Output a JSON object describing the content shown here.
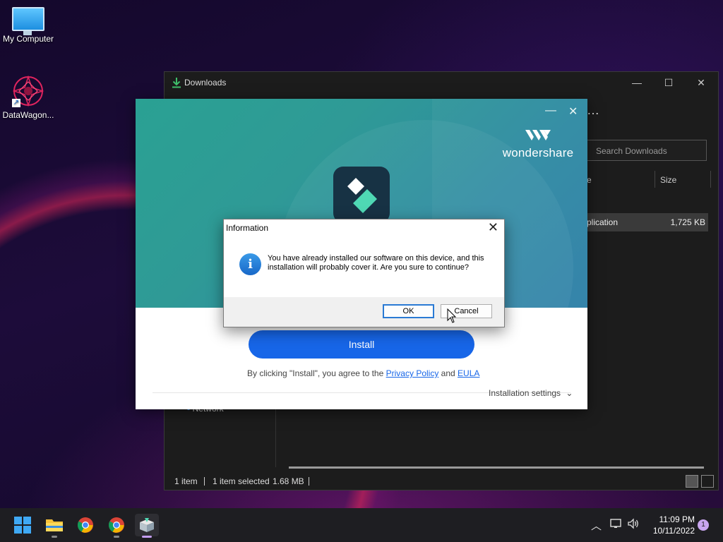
{
  "desktop": {
    "icons": [
      {
        "label": "My Computer"
      },
      {
        "label": "DataWagon..."
      }
    ]
  },
  "explorer": {
    "title": "Downloads",
    "search_placeholder": "Search Downloads",
    "columns": {
      "type_partial": "e",
      "size": "Size"
    },
    "file": {
      "type_partial": "plication",
      "size": "1,725 KB"
    },
    "nav_partial": "Network",
    "status": {
      "count": "1 item",
      "selected": "1 item selected",
      "size": "1.68 MB"
    }
  },
  "installer": {
    "brand": "wondershare",
    "install_label": "Install",
    "agree_text": "By clicking \"Install\", you agree to the",
    "privacy_label": "Privacy Policy",
    "and_text": "and",
    "eula_label": "EULA",
    "settings_label": "Installation settings"
  },
  "dialog": {
    "title": "Information",
    "message": "You have already installed our software on this device, and this installation will probably cover it. Are you sure to continue?",
    "ok_label": "OK",
    "cancel_label": "Cancel"
  },
  "taskbar": {
    "time": "11:09 PM",
    "date": "10/11/2022",
    "notification_count": "1"
  },
  "colors": {
    "install_blue": "#1766e8",
    "hero_teal": "#2aa193",
    "accent_purple": "#c49ef2"
  }
}
